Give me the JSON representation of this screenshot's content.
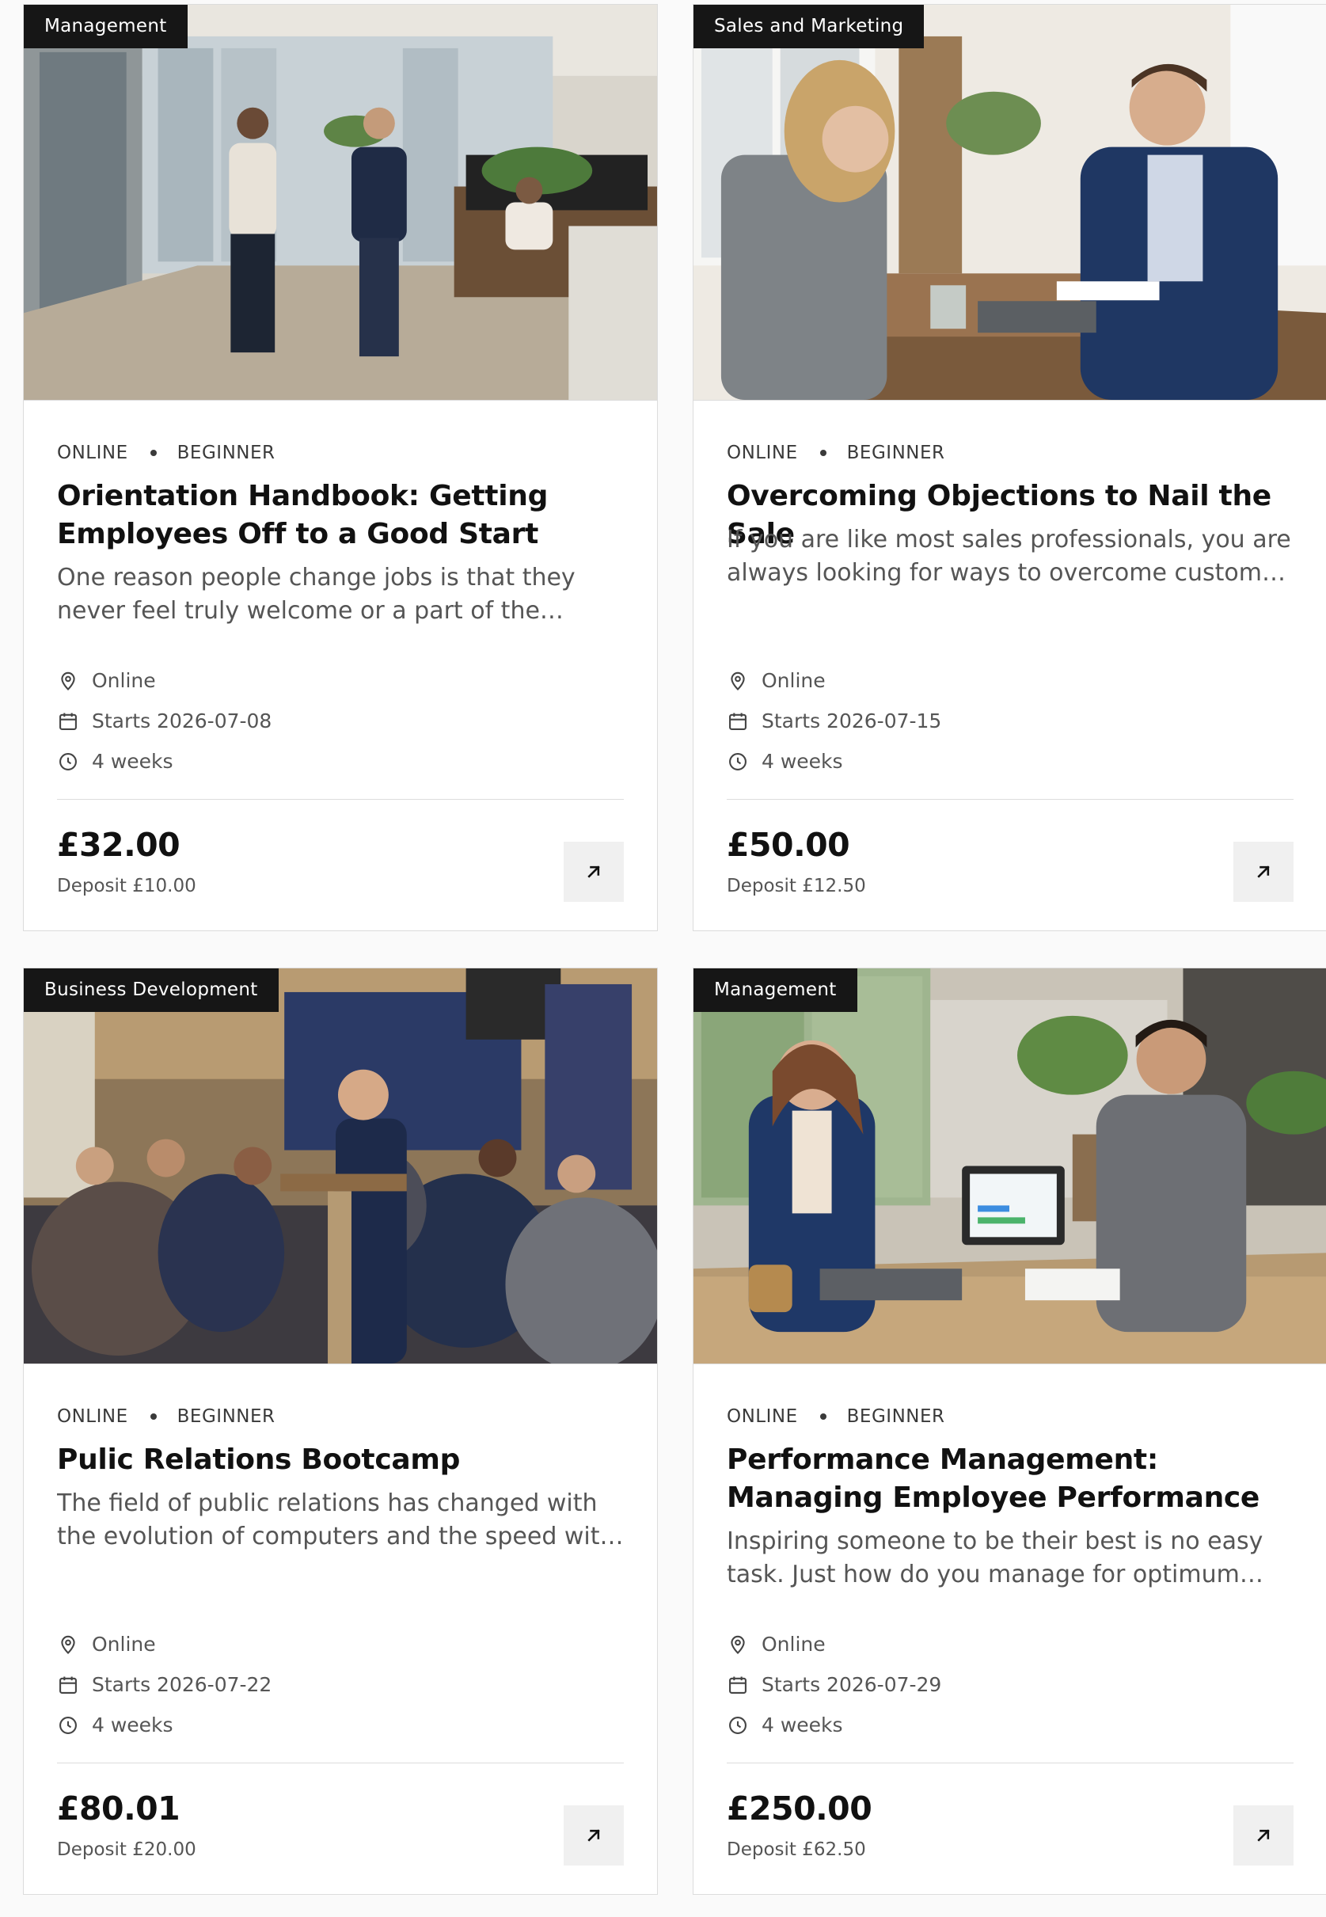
{
  "icons": {
    "location": "location-pin-icon",
    "calendar": "calendar-icon",
    "duration": "clock-icon",
    "open": "arrow-up-right-icon"
  },
  "colors": {
    "badge_bg": "#161616",
    "badge_text": "#ffffff",
    "button_bg": "#f0f0f0"
  },
  "courses": [
    {
      "category": "Management",
      "image_alt": "People walking through a bright open-plan office",
      "delivery": "ONLINE",
      "level": "BEGINNER",
      "title": "Orientation Handbook: Getting Employees Off to a Good Start",
      "description": "One reason people change jobs is that they never feel truly welcome or a part of the organization they work for.",
      "location": "Online",
      "starts": "Starts 2026-07-08",
      "duration": "4 weeks",
      "price": "£32.00",
      "deposit": "Deposit £10.00"
    },
    {
      "category": "Sales and Marketing",
      "image_alt": "Salesperson and client talking at a wooden table",
      "delivery": "ONLINE",
      "level": "BEGINNER",
      "title": "Overcoming Objections to Nail the Sale",
      "description": "If you are like most sales professionals, you are always looking for ways to overcome customer objections.",
      "location": "Online",
      "starts": "Starts 2026-07-15",
      "duration": "4 weeks",
      "price": "£50.00",
      "deposit": "Deposit £12.50"
    },
    {
      "category": "Business Development",
      "image_alt": "Speaker at a podium in front of press event audience",
      "delivery": "ONLINE",
      "level": "BEGINNER",
      "title": "Pulic Relations Bootcamp",
      "description": "The field of public relations has changed with the evolution of computers and the speed with which information travels.",
      "location": "Online",
      "starts": "Starts 2026-07-22",
      "duration": "4 weeks",
      "price": "£80.01",
      "deposit": "Deposit £20.00"
    },
    {
      "category": "Management",
      "image_alt": "Manager reviewing a tablet dashboard with an employee",
      "delivery": "ONLINE",
      "level": "BEGINNER",
      "title": "Performance Management: Managing Employee Performance",
      "description": "Inspiring someone to be their best is no easy task. Just how do you manage for optimum performance in your team?",
      "location": "Online",
      "starts": "Starts 2026-07-29",
      "duration": "4 weeks",
      "price": "£250.00",
      "deposit": "Deposit £62.50"
    }
  ]
}
